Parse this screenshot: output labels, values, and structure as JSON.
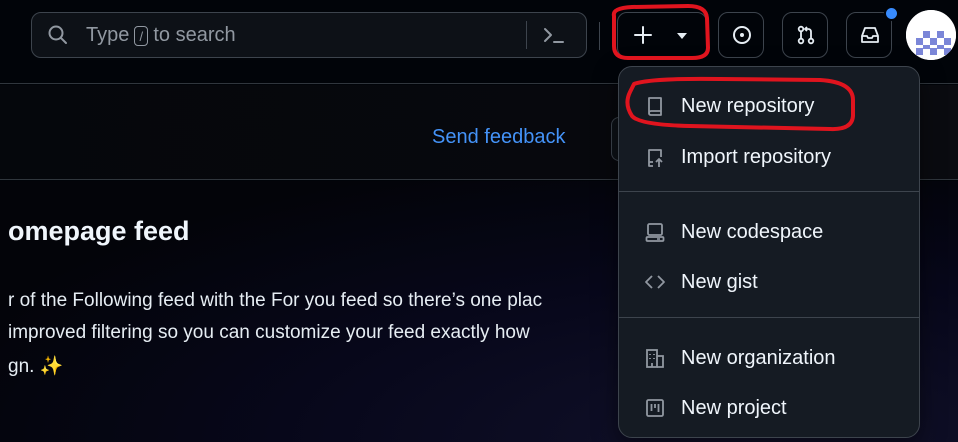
{
  "header": {
    "search": {
      "prefix": "Type",
      "key": "/",
      "suffix": "to search"
    },
    "create_button": {
      "icons": [
        "plus-icon",
        "triangle-down-icon"
      ]
    },
    "issues_button": {
      "icon": "issue-opened-icon"
    },
    "pull_requests_button": {
      "icon": "git-pull-request-icon"
    },
    "inbox_button": {
      "icon": "inbox-icon",
      "has_unread": true
    },
    "avatar": {
      "icon": "identicon-avatar"
    }
  },
  "feedback": {
    "label": "Send feedback"
  },
  "feed": {
    "title": "omepage feed",
    "lines": [
      "r of the Following feed with the For you feed so there’s one plac",
      "improved filtering so you can customize your feed exactly how",
      "gn."
    ],
    "sparkle": "✨"
  },
  "create_menu": {
    "groups": [
      [
        {
          "label": "New repository",
          "icon": "repo-icon"
        },
        {
          "label": "Import repository",
          "icon": "repo-push-icon"
        }
      ],
      [
        {
          "label": "New codespace",
          "icon": "codespaces-icon"
        },
        {
          "label": "New gist",
          "icon": "code-icon"
        }
      ],
      [
        {
          "label": "New organization",
          "icon": "organization-icon"
        },
        {
          "label": "New project",
          "icon": "project-icon"
        }
      ]
    ]
  },
  "colors": {
    "background": "#010409",
    "menu_background": "#151b23",
    "border": "#3d444d",
    "link": "#4493f8",
    "notification": "#388bfd",
    "annotation": "#e0141e"
  }
}
